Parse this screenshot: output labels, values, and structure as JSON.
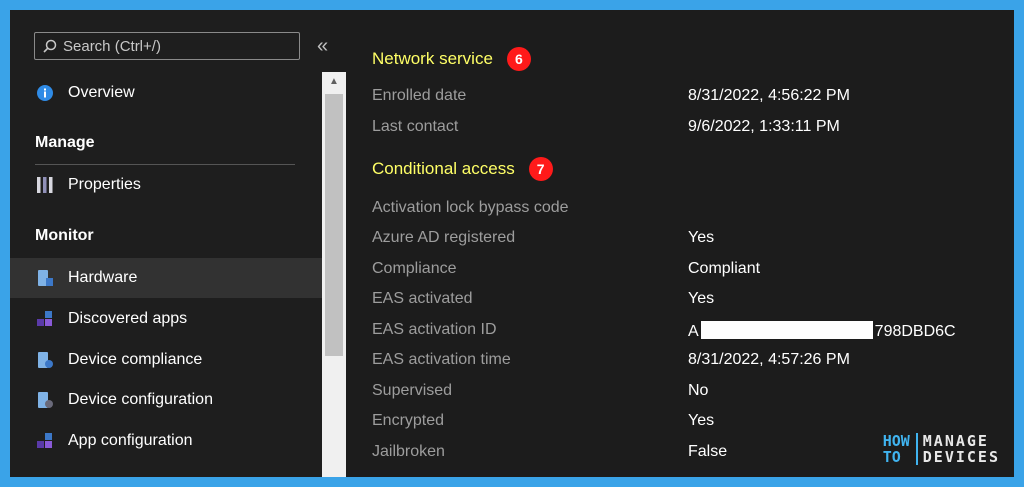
{
  "sidebar": {
    "search_placeholder": "Search (Ctrl+/)",
    "collapse_glyph": "«",
    "overview": "Overview",
    "manage_label": "Manage",
    "properties": "Properties",
    "monitor_label": "Monitor",
    "items": [
      {
        "label": "Hardware",
        "active": true
      },
      {
        "label": "Discovered apps"
      },
      {
        "label": "Device compliance"
      },
      {
        "label": "Device configuration"
      },
      {
        "label": "App configuration"
      }
    ]
  },
  "content": {
    "network_service": {
      "title": "Network service",
      "badge": "6"
    },
    "conditional_access": {
      "title": "Conditional access",
      "badge": "7"
    },
    "rows": [
      {
        "label": "Enrolled date",
        "value": "8/31/2022, 4:56:22 PM"
      },
      {
        "label": "Last contact",
        "value": "9/6/2022, 1:33:11 PM"
      },
      {
        "label": "Activation lock bypass code",
        "value": ""
      },
      {
        "label": "Azure AD registered",
        "value": "Yes"
      },
      {
        "label": "Compliance",
        "value": "Compliant"
      },
      {
        "label": "EAS activated",
        "value": "Yes"
      },
      {
        "label": "EAS activation ID",
        "value_prefix": "A",
        "value_suffix": "798DBD6C"
      },
      {
        "label": "EAS activation time",
        "value": "8/31/2022, 4:57:26 PM"
      },
      {
        "label": "Supervised",
        "value": "No"
      },
      {
        "label": "Encrypted",
        "value": "Yes"
      },
      {
        "label": "Jailbroken",
        "value": "False"
      }
    ]
  },
  "logo": {
    "how": "HOW",
    "to": "TO",
    "manage": "MANAGE",
    "devices": "DEVICES"
  },
  "colors": {
    "accent_heading": "#ffff66",
    "badge": "#ff1a1a",
    "frame_border": "#3aa3e8"
  }
}
